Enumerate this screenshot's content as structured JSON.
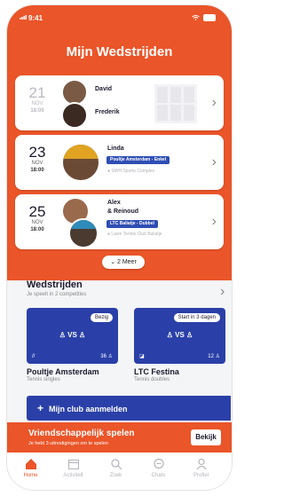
{
  "status_bar": {
    "time": "9:41"
  },
  "header": {
    "title": "Mijn Wedstrijden"
  },
  "matches": [
    {
      "day": "21",
      "month": "NOV",
      "time": "18:00",
      "players": "David",
      "players2": "Frederik"
    },
    {
      "day": "23",
      "month": "NOV",
      "time": "18:00",
      "players": "Linda",
      "tag": "Poultje Amsterdam - Enkel",
      "location": "SWH Sports Complex"
    },
    {
      "day": "25",
      "month": "NOV",
      "time": "18:00",
      "players": "Alex",
      "players2": "& Reinoud",
      "tag": "LTC Baliatje - Dubbel",
      "location": "Lawn Tennis Club Baliatje"
    }
  ],
  "more_button": {
    "label": "2 Meer"
  },
  "competitions_section": {
    "title": "Wedstrijden",
    "subtitle": "Je speelt in 2 competities"
  },
  "competitions": [
    {
      "status": "Bezig",
      "vs": "VS",
      "icon_text": "//",
      "count": "36",
      "name": "Poultje Amsterdam",
      "type": "Tennis singles"
    },
    {
      "status": "Start in 3 dagen",
      "vs": "VS",
      "icon_text": "",
      "count": "12",
      "name": "LTC Festina",
      "type": "Tennis doubles"
    }
  ],
  "club_button": {
    "label": "Mijn club aanmelden"
  },
  "friendly": {
    "title": "Vriendschappelijk spelen",
    "subtitle": "Je hebt 3 uitnodigingen om te spelen",
    "button": "Bekijk"
  },
  "nav": [
    {
      "label": "Home",
      "icon": "home-icon"
    },
    {
      "label": "Activiteit",
      "icon": "calendar-icon"
    },
    {
      "label": "Zoek",
      "icon": "search-icon"
    },
    {
      "label": "Chats",
      "icon": "chat-icon"
    },
    {
      "label": "Profiel",
      "icon": "profile-icon"
    }
  ],
  "colors": {
    "accent": "#ea5529",
    "blue": "#2a40a8",
    "tag_blue": "#2f4eb3"
  }
}
